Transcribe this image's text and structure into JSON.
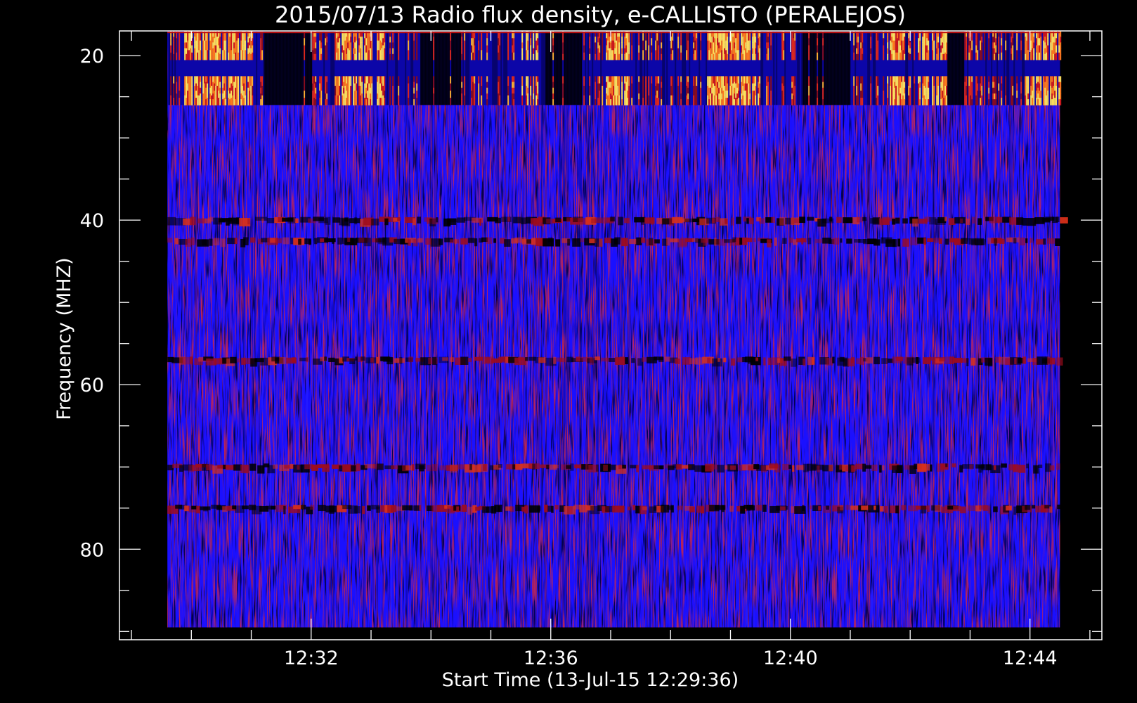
{
  "chart_data": {
    "type": "heatmap",
    "title": "2015/07/13  Radio flux density, e-CALLISTO (PERALEJOS)",
    "xlabel": "Start Time (13-Jul-15 12:29:36)",
    "ylabel": "Frequency (MHZ)",
    "x_ticks": [
      "12:32",
      "12:36",
      "12:40",
      "12:44"
    ],
    "x_tick_minutes": [
      2.4,
      6.4,
      10.4,
      14.4
    ],
    "xlim_minutes": [
      -0.8,
      15.6
    ],
    "data_x_range_minutes": [
      0.0,
      14.9
    ],
    "y_ticks": [
      20,
      40,
      60,
      80
    ],
    "ylim": [
      17,
      91
    ],
    "data_y_range": [
      17.1,
      89.5
    ],
    "y_minor_step": 5,
    "x_minor_step": 1,
    "y_inverted": true,
    "colormap": [
      "#000000",
      "#1a10ff",
      "#8b0b1a",
      "#ff3a10",
      "#ffd050",
      "#ffff90"
    ],
    "features": {
      "strong_bands_mhz": [
        [
          17,
          20.5
        ],
        [
          22.5,
          26
        ]
      ],
      "dark_columns_minutes": [
        [
          1.6,
          2.4
        ],
        [
          4.2,
          4.9
        ],
        [
          6.3,
          6.9
        ],
        [
          10.6,
          11.4
        ],
        [
          13.0,
          13.3
        ]
      ],
      "bright_columns_minutes": [
        [
          0.2,
          1.4
        ],
        [
          2.8,
          3.6
        ],
        [
          5.8,
          6.2
        ],
        [
          7.3,
          7.7
        ],
        [
          9.0,
          9.9
        ],
        [
          12.0,
          12.3
        ],
        [
          12.5,
          13.0
        ],
        [
          14.3,
          14.9
        ]
      ],
      "horizontal_bands_mhz": [
        40,
        42.5,
        57,
        70,
        75
      ]
    }
  },
  "colors": {
    "background": "#000000",
    "axes": "#ffffff",
    "text": "#ffffff"
  }
}
